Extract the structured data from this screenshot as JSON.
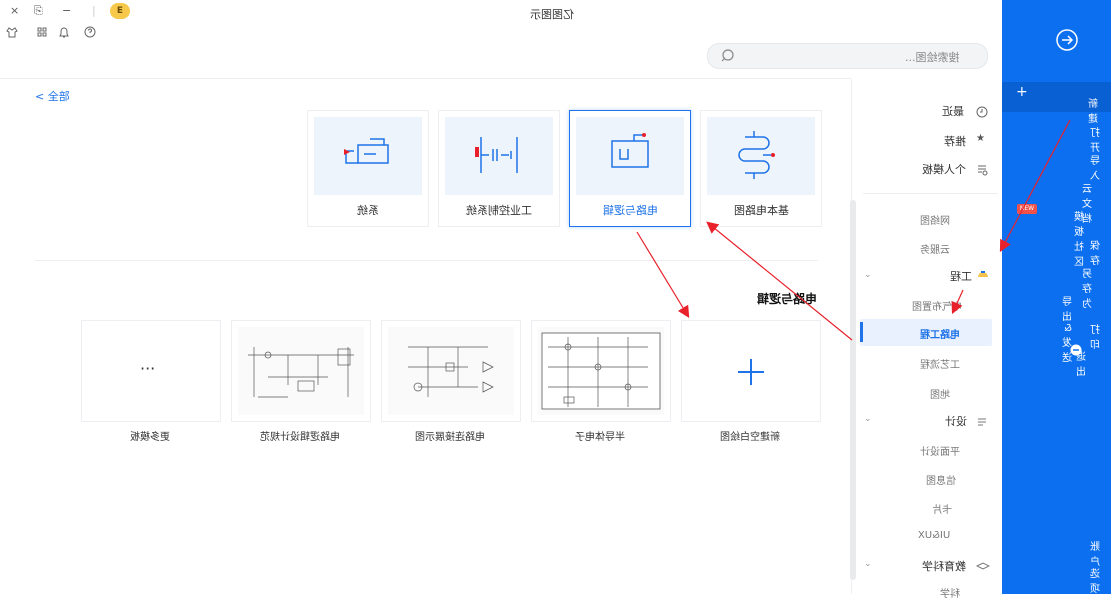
{
  "window": {
    "title": "亿图图示",
    "controls": [
      "×",
      "⎘",
      "−",
      "|",
      "E"
    ],
    "toolbar_icons": [
      "shirt-icon",
      "grid-icon",
      "bell-icon",
      "help-icon"
    ]
  },
  "search": {
    "placeholder": "搜索绘图..."
  },
  "breadcrumb": {
    "label": "< 全部"
  },
  "blue_panel": {
    "items": [
      {
        "label": "新建",
        "icon": "plus-icon"
      },
      {
        "label": "打开"
      },
      {
        "label": "导入"
      },
      {
        "label": "云文档"
      },
      {
        "label": "模板社区",
        "badge": "NEW"
      },
      {
        "label": "保存"
      },
      {
        "label": "另存为"
      },
      {
        "label": "导出 & 发送"
      },
      {
        "label": "打印"
      },
      {
        "label": "退出",
        "icon": "minus-circle-icon"
      },
      {
        "label": "账户"
      },
      {
        "label": "选项"
      }
    ]
  },
  "nav": {
    "top_items": [
      {
        "label": "最近",
        "icon": "clock-icon"
      },
      {
        "label": "推荐",
        "icon": "star-icon"
      },
      {
        "label": "个人模板",
        "icon": "user-template-icon"
      }
    ],
    "group_items": [
      {
        "label": "网络图"
      },
      {
        "label": "云服务"
      }
    ],
    "engineering": {
      "label": "工程",
      "children": [
        "电气布置图",
        "电路工程",
        "工艺流程",
        "地图"
      ]
    },
    "design": {
      "label": "设计",
      "children": [
        "平面设计",
        "信息图",
        "卡片",
        "UI&UX"
      ]
    },
    "education": {
      "label": "教育科学",
      "children": [
        "科学"
      ]
    }
  },
  "categories": [
    {
      "label": "基本电路图"
    },
    {
      "label": "电路与逻辑"
    },
    {
      "label": "工业控制系统"
    },
    {
      "label": "系统"
    }
  ],
  "section_title": "电路与逻辑",
  "templates": [
    {
      "label": "新建空白绘图",
      "thumb": "plus-icon"
    },
    {
      "label": "半导体电子"
    },
    {
      "label": "电路连接展示图"
    },
    {
      "label": "电路逻辑设计规范"
    },
    {
      "label": "更多模板",
      "thumb": "ellipsis-icon"
    }
  ],
  "colors": {
    "accent": "#1f73e8",
    "panel_blue": "#0b6ff0",
    "annotation_red": "#e8212b"
  }
}
